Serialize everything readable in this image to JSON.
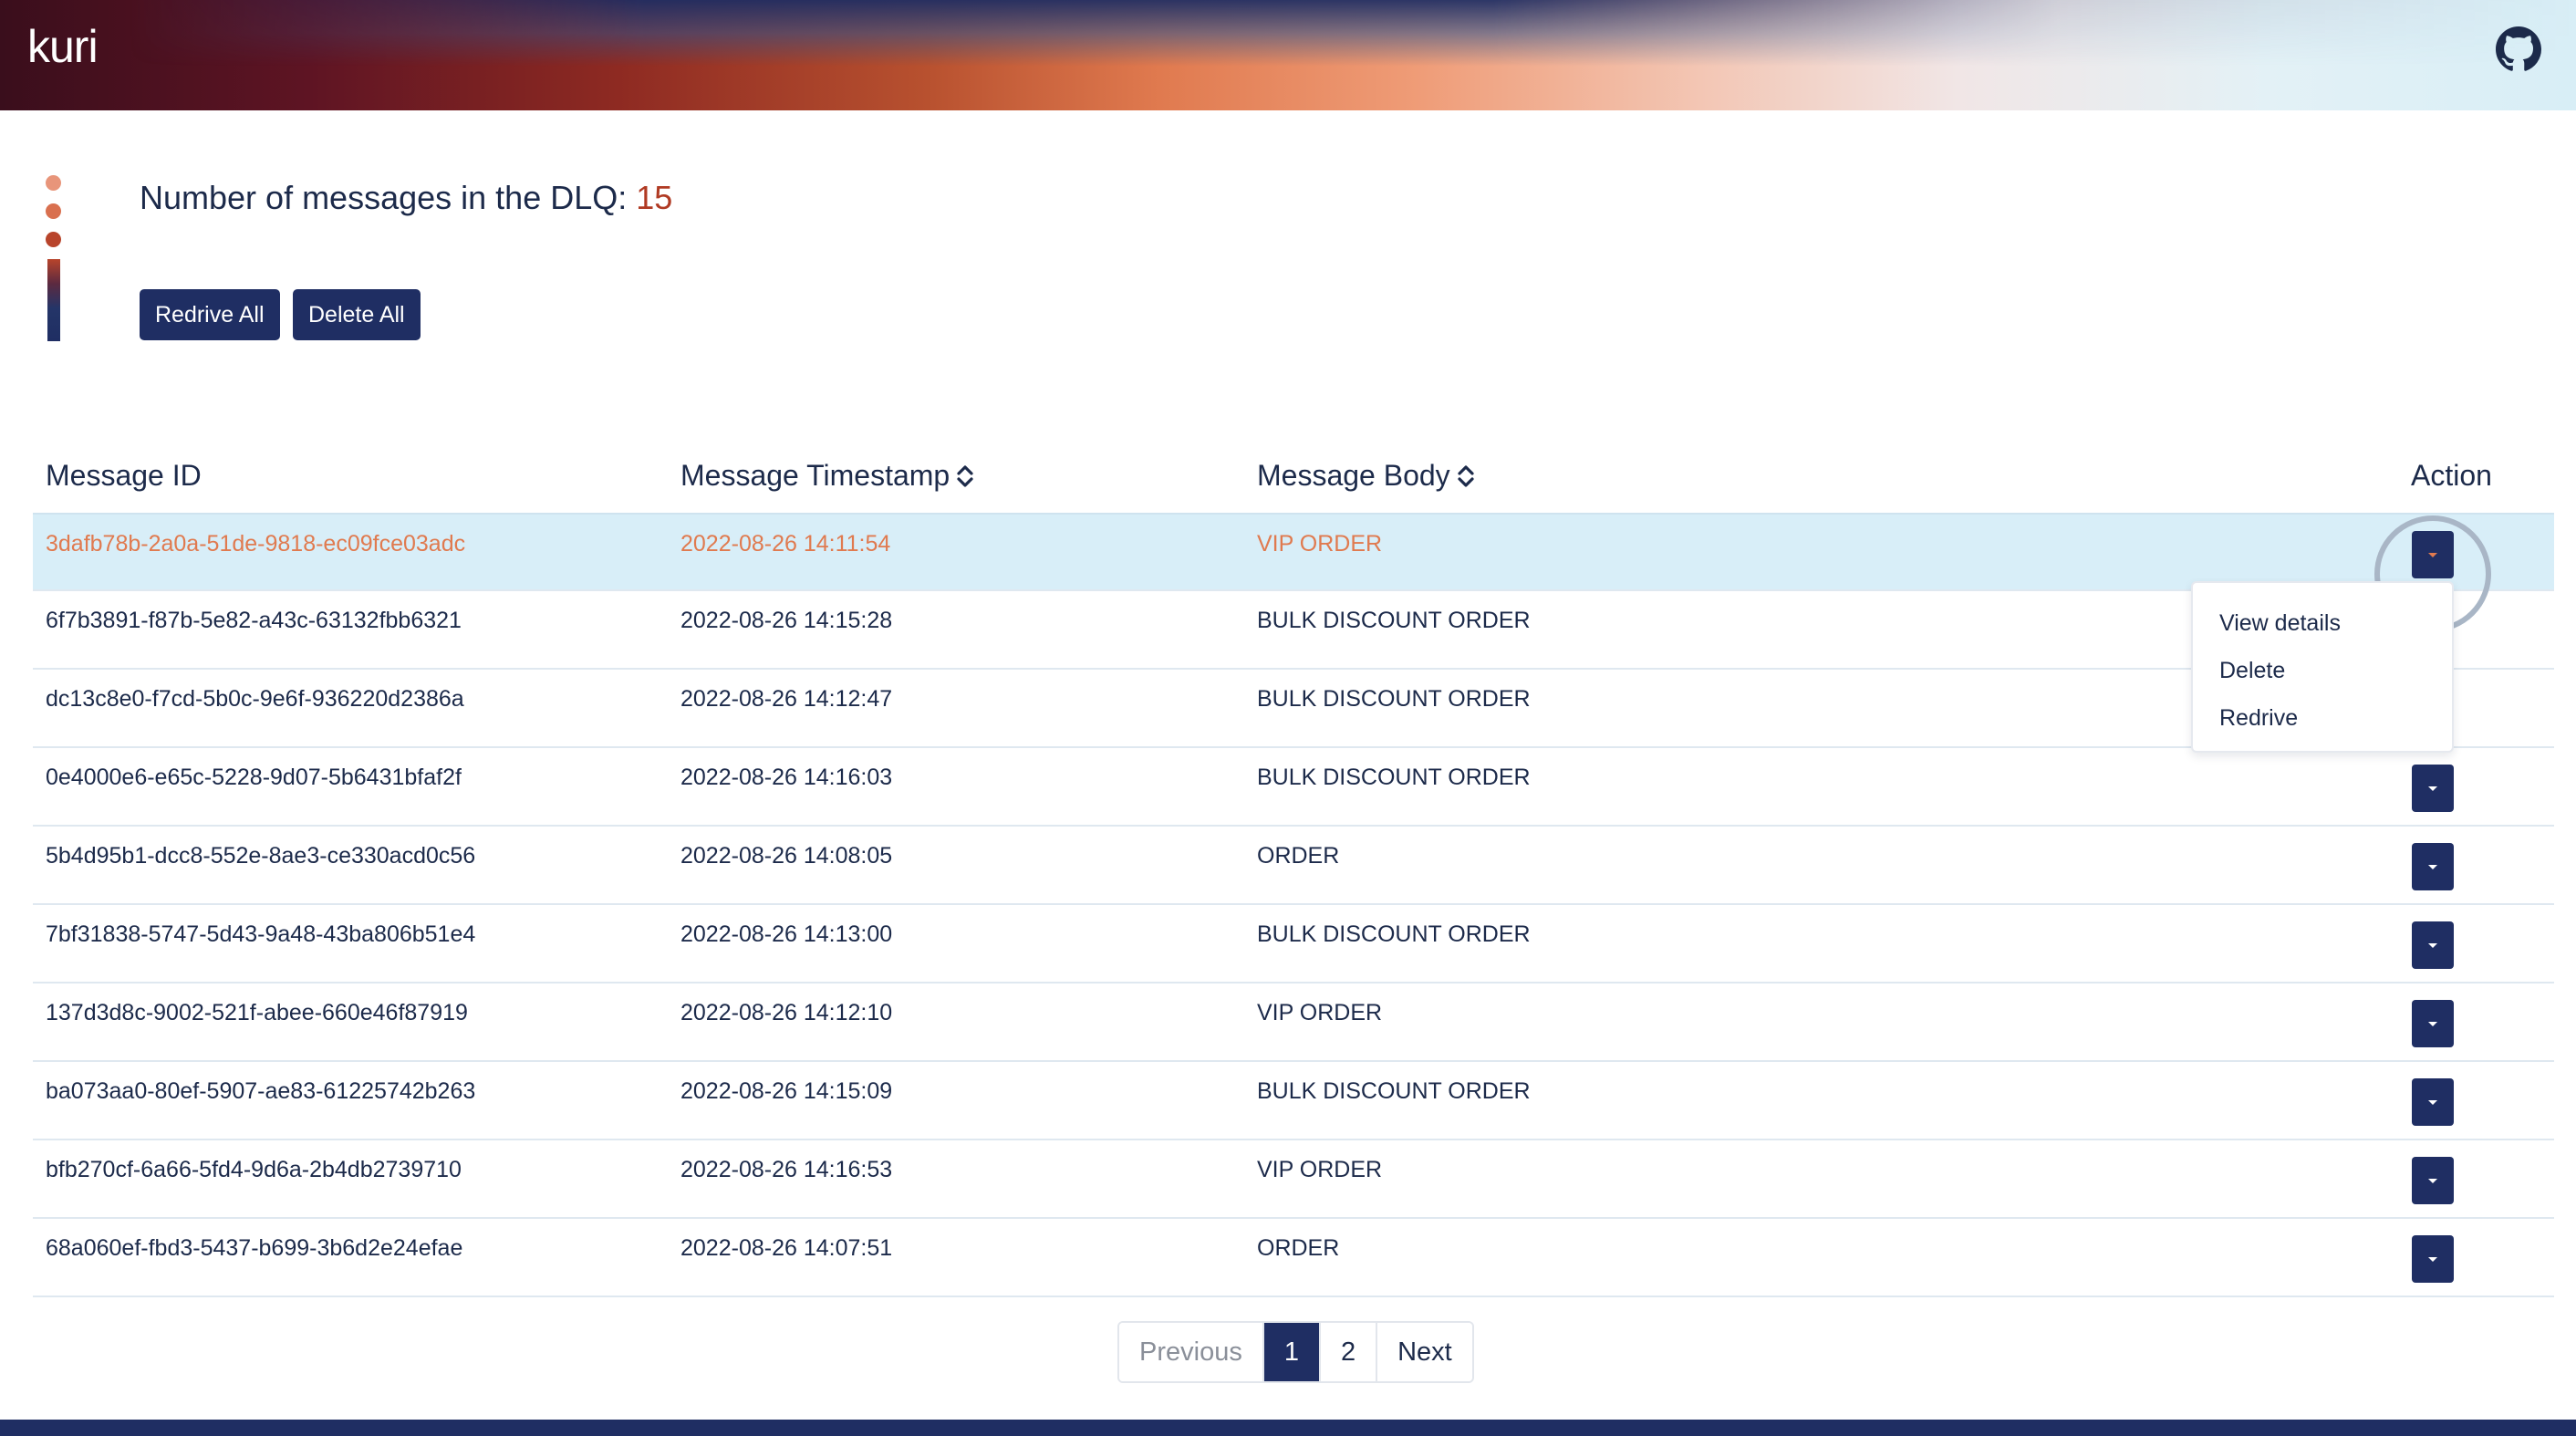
{
  "header": {
    "logo": "kuri",
    "github_icon": "github-icon"
  },
  "summary": {
    "label": "Number of messages in the DLQ:",
    "count": "15",
    "redrive_all": "Redrive All",
    "delete_all": "Delete All"
  },
  "table": {
    "columns": [
      "Message ID",
      "Message Timestamp",
      "Message Body",
      "Action"
    ],
    "sortable_icon": "sort-icon",
    "rows": [
      {
        "id": "3dafb78b-2a0a-51de-9818-ec09fce03adc",
        "timestamp": "2022-08-26 14:11:54",
        "body": "VIP ORDER"
      },
      {
        "id": "6f7b3891-f87b-5e82-a43c-63132fbb6321",
        "timestamp": "2022-08-26 14:15:28",
        "body": "BULK DISCOUNT ORDER"
      },
      {
        "id": "dc13c8e0-f7cd-5b0c-9e6f-936220d2386a",
        "timestamp": "2022-08-26 14:12:47",
        "body": "BULK DISCOUNT ORDER"
      },
      {
        "id": "0e4000e6-e65c-5228-9d07-5b6431bfaf2f",
        "timestamp": "2022-08-26 14:16:03",
        "body": "BULK DISCOUNT ORDER"
      },
      {
        "id": "5b4d95b1-dcc8-552e-8ae3-ce330acd0c56",
        "timestamp": "2022-08-26 14:08:05",
        "body": "ORDER"
      },
      {
        "id": "7bf31838-5747-5d43-9a48-43ba806b51e4",
        "timestamp": "2022-08-26 14:13:00",
        "body": "BULK DISCOUNT ORDER"
      },
      {
        "id": "137d3d8c-9002-521f-abee-660e46f87919",
        "timestamp": "2022-08-26 14:12:10",
        "body": "VIP ORDER"
      },
      {
        "id": "ba073aa0-80ef-5907-ae83-61225742b263",
        "timestamp": "2022-08-26 14:15:09",
        "body": "BULK DISCOUNT ORDER"
      },
      {
        "id": "bfb270cf-6a66-5fd4-9d6a-2b4db2739710",
        "timestamp": "2022-08-26 14:16:53",
        "body": "VIP ORDER"
      },
      {
        "id": "68a060ef-fbd3-5437-b699-3b6d2e24efae",
        "timestamp": "2022-08-26 14:07:51",
        "body": "ORDER"
      }
    ],
    "selected_row": 0
  },
  "action_menu": {
    "items": [
      "View details",
      "Delete",
      "Redrive"
    ]
  },
  "pagination": {
    "previous": "Previous",
    "pages": [
      "1",
      "2"
    ],
    "active_page": "1",
    "next": "Next"
  },
  "colors": {
    "primary": "#1f2e63",
    "accent": "#e07a4f",
    "count": "#b03a23",
    "selected_row": "#d8eef8"
  }
}
